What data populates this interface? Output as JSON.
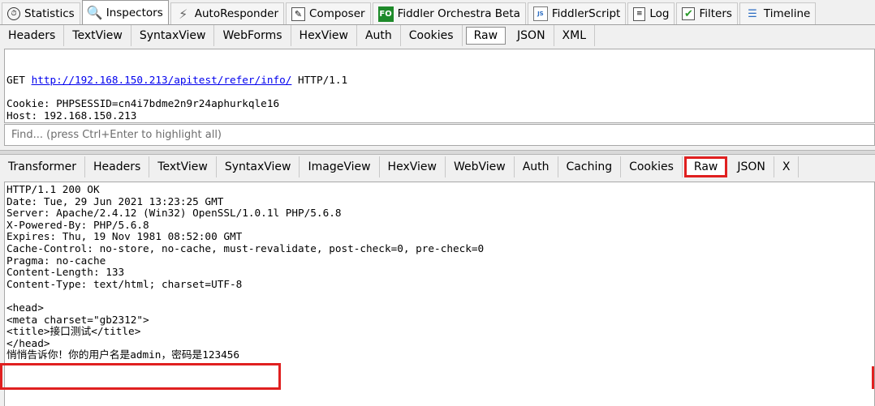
{
  "main_tabs": [
    {
      "label": "Statistics",
      "icon": "stopwatch-icon",
      "glyph": "⏱",
      "active": false
    },
    {
      "label": "Inspectors",
      "icon": "magnifier-icon",
      "glyph": "🔍",
      "active": true
    },
    {
      "label": "AutoResponder",
      "icon": "lightning-icon",
      "glyph": "⚡",
      "active": false
    },
    {
      "label": "Composer",
      "icon": "pencil-icon",
      "glyph": "✎",
      "active": false
    },
    {
      "label": "Fiddler Orchestra Beta",
      "icon": "fo-logo-icon",
      "glyph": "FO",
      "active": false
    },
    {
      "label": "FiddlerScript",
      "icon": "script-icon",
      "glyph": "JS",
      "active": false
    },
    {
      "label": "Log",
      "icon": "log-icon",
      "glyph": "≡",
      "active": false
    },
    {
      "label": "Filters",
      "icon": "checkbox-icon",
      "glyph": "✔",
      "active": false
    },
    {
      "label": "Timeline",
      "icon": "timeline-icon",
      "glyph": "☰",
      "active": false
    }
  ],
  "request": {
    "tabs": [
      "Headers",
      "TextView",
      "SyntaxView",
      "WebForms",
      "HexView",
      "Auth",
      "Cookies",
      "Raw",
      "JSON",
      "XML"
    ],
    "active_tab": "Raw",
    "method": "GET",
    "url": "http://192.168.150.213/apitest/refer/info/",
    "protocol": "HTTP/1.1",
    "lines": [
      "Cookie: PHPSESSID=cn4i7bdme2n9r24aphurkqle16",
      "Host: 192.168.150.213"
    ],
    "find_placeholder": "Find... (press Ctrl+Enter to highlight all)"
  },
  "response": {
    "tabs": [
      "Transformer",
      "Headers",
      "TextView",
      "SyntaxView",
      "ImageView",
      "HexView",
      "WebView",
      "Auth",
      "Caching",
      "Cookies",
      "Raw",
      "JSON",
      "X"
    ],
    "active_tab": "Raw",
    "lines": [
      "HTTP/1.1 200 OK",
      "Date: Tue, 29 Jun 2021 13:23:25 GMT",
      "Server: Apache/2.4.12 (Win32) OpenSSL/1.0.1l PHP/5.6.8",
      "X-Powered-By: PHP/5.6.8",
      "Expires: Thu, 19 Nov 1981 08:52:00 GMT",
      "Cache-Control: no-store, no-cache, must-revalidate, post-check=0, pre-check=0",
      "Pragma: no-cache",
      "Content-Length: 133",
      "Content-Type: text/html; charset=UTF-8",
      "",
      "<head>",
      "<meta charset=\"gb2312\">",
      "<title>接口测试</title>",
      "</head>",
      "悄悄告诉你！你的用户名是admin，密码是123456"
    ]
  },
  "colors": {
    "highlight": "#e02020",
    "link": "#0000ee"
  }
}
